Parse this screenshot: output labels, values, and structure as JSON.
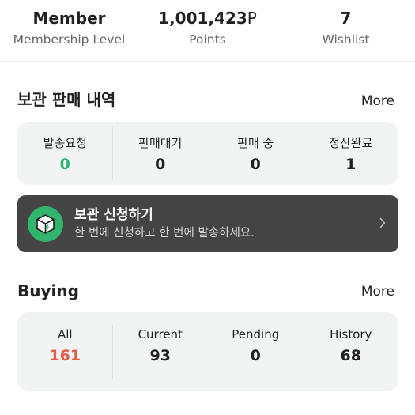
{
  "top_stats": [
    {
      "value": "Member",
      "unit": "",
      "label": "Membership Level"
    },
    {
      "value": "1,001,423",
      "unit": "P",
      "label": "Points"
    },
    {
      "value": "7",
      "unit": "",
      "label": "Wishlist"
    }
  ],
  "storage_sales": {
    "title": "보관 판매 내역",
    "more_label": "More",
    "items": [
      {
        "label": "발송요청",
        "value": "0",
        "color": "#31b46c"
      },
      {
        "label": "판매대기",
        "value": "0",
        "color": "#222222"
      },
      {
        "label": "판매 중",
        "value": "0",
        "color": "#222222"
      },
      {
        "label": "정산완료",
        "value": "1",
        "color": "#222222"
      }
    ]
  },
  "banner": {
    "icon": "box-upload-icon",
    "title": "보관 신청하기",
    "subtitle": "한 번에 신청하고 한 번에 발송하세요.",
    "chevron": "chevron-right-icon"
  },
  "buying": {
    "title": "Buying",
    "more_label": "More",
    "items": [
      {
        "label": "All",
        "value": "161",
        "color": "#e05d4a"
      },
      {
        "label": "Current",
        "value": "93",
        "color": "#222222"
      },
      {
        "label": "Pending",
        "value": "0",
        "color": "#222222"
      },
      {
        "label": "History",
        "value": "68",
        "color": "#222222"
      }
    ]
  },
  "colors": {
    "accent_green": "#31b46c",
    "accent_red": "#e05d4a",
    "banner_bg": "#444444",
    "box_bg": "#f2f4f4"
  }
}
